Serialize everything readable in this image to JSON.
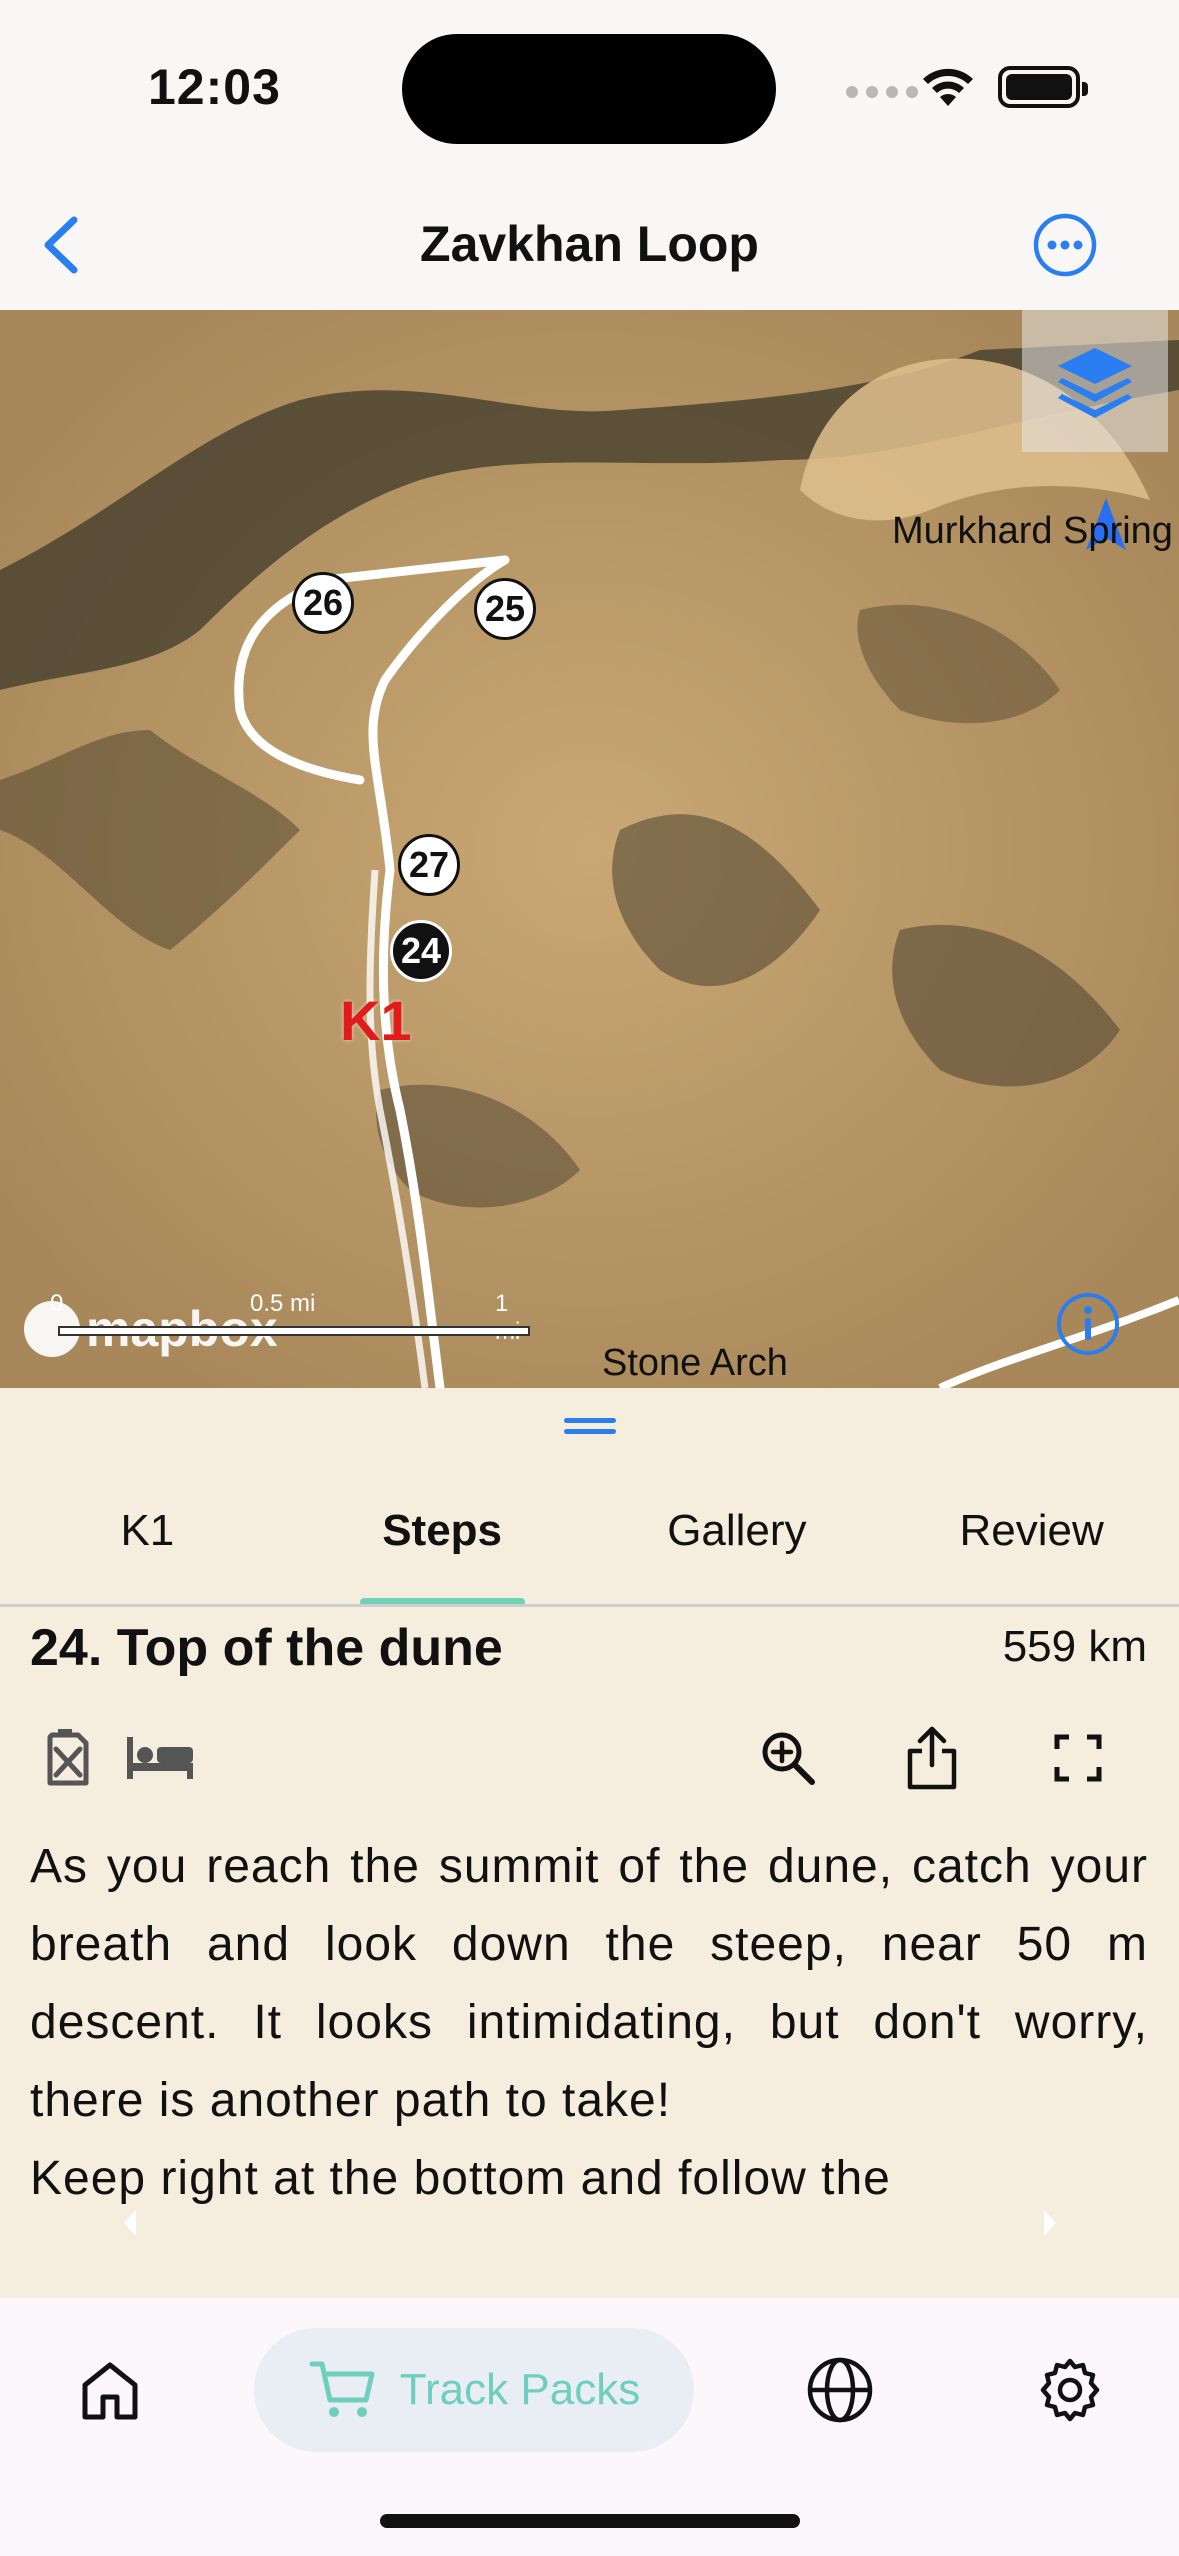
{
  "status_bar": {
    "time": "12:03"
  },
  "header": {
    "title": "Zavkhan Loop"
  },
  "map": {
    "place_labels": [
      "Murkhard Spring",
      "Stone Arch"
    ],
    "waypoints": [
      {
        "label": "26"
      },
      {
        "label": "25"
      },
      {
        "label": "27"
      },
      {
        "label": "24",
        "active": true
      }
    ],
    "marker_label": "K1",
    "scale": {
      "labels": [
        "0",
        "0.5 mi",
        "1 mi"
      ]
    },
    "attribution": "mapbox"
  },
  "sheet": {
    "tabs": [
      {
        "label": "K1"
      },
      {
        "label": "Steps",
        "active": true
      },
      {
        "label": "Gallery"
      },
      {
        "label": "Review"
      }
    ],
    "step": {
      "title": "24. Top of the dune",
      "distance": "559 km",
      "icons": [
        "fuel-icon",
        "bed-icon",
        "zoom-in-icon",
        "share-icon",
        "fullscreen-icon"
      ],
      "description_1": "As you reach the summit of the dune, catch your breath and look down the steep, near 50 m descent. It looks intimidating, but don't worry, there is another path to take!",
      "description_2": "Keep right at the bottom and follow the"
    }
  },
  "tab_bar": {
    "items": [
      {
        "icon": "home-icon"
      },
      {
        "icon": "cart-icon",
        "label": "Track Packs",
        "active": true
      },
      {
        "icon": "globe-icon"
      },
      {
        "icon": "gear-icon"
      }
    ]
  },
  "colors": {
    "accent_blue": "#2a7ef0",
    "accent_teal": "#6dd3b6",
    "sheet_bg": "#f5edde",
    "marker_red": "#e31a1a"
  }
}
